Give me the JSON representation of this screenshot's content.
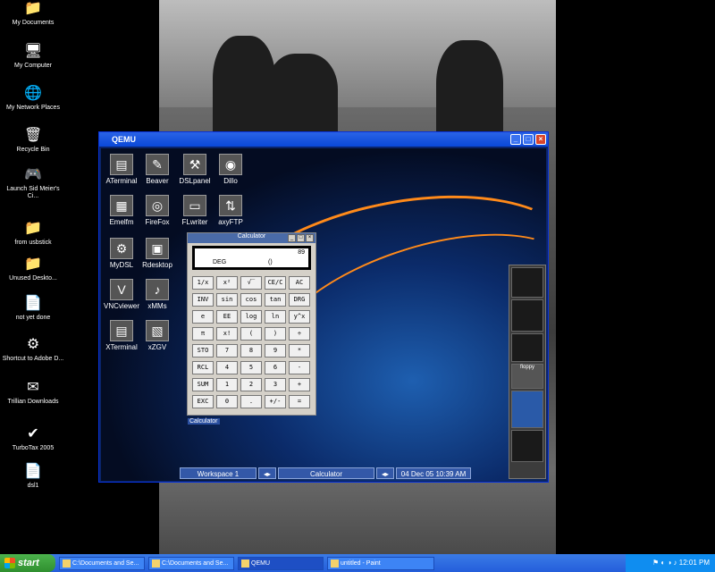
{
  "desktop_icons": [
    {
      "name": "my-documents-icon",
      "label": "My Documents",
      "glyph": "📁"
    },
    {
      "name": "my-computer-icon",
      "label": "My Computer",
      "glyph": "🖥"
    },
    {
      "name": "network-places-icon",
      "label": "My Network Places",
      "glyph": "🌐"
    },
    {
      "name": "recycle-bin-icon",
      "label": "Recycle Bin",
      "glyph": "🗑"
    },
    {
      "name": "civ-icon",
      "label": "Launch Sid Meier's Ci...",
      "glyph": "🎮"
    },
    {
      "name": "folder-icon",
      "label": "from usbstick",
      "glyph": "📁"
    },
    {
      "name": "folder-icon",
      "label": "Unused Deskto...",
      "glyph": "📁"
    },
    {
      "name": "document-icon",
      "label": "not yet done",
      "glyph": "📄"
    },
    {
      "name": "shortcut-icon",
      "label": "Shortcut to Adobe D...",
      "glyph": "⚙"
    },
    {
      "name": "trillian-icon",
      "label": "Trillian Downloads",
      "glyph": "✉"
    },
    {
      "name": "turbotax-icon",
      "label": "TurboTax 2005",
      "glyph": "✔"
    },
    {
      "name": "dsl-file-icon",
      "label": "dsl1",
      "glyph": "📄"
    }
  ],
  "qemu": {
    "title": "QEMU",
    "icons": [
      {
        "label": "ATerminal",
        "glyph": "▤"
      },
      {
        "label": "Beaver",
        "glyph": "✎"
      },
      {
        "label": "DSLpanel",
        "glyph": "⚒"
      },
      {
        "label": "Dillo",
        "glyph": "◉"
      },
      {
        "label": "Emelfm",
        "glyph": "▦"
      },
      {
        "label": "FireFox",
        "glyph": "◎"
      },
      {
        "label": "FLwriter",
        "glyph": "▭"
      },
      {
        "label": "axyFTP",
        "glyph": "⇅"
      },
      {
        "label": "MyDSL",
        "glyph": "⚙"
      },
      {
        "label": "Rdesktop",
        "glyph": "▣"
      },
      {
        "label": "VNCviewer",
        "glyph": "V"
      },
      {
        "label": "xMMs",
        "glyph": "♪"
      },
      {
        "label": "XTerminal",
        "glyph": "▤"
      },
      {
        "label": "xZGV",
        "glyph": "▧"
      }
    ],
    "calculator": {
      "title": "Calculator",
      "display_value": "89",
      "angle_mode": "DEG",
      "paren": "()",
      "keys": [
        "1/x",
        "x²",
        "√‾",
        "CE/C",
        "AC",
        "INV",
        "sin",
        "cos",
        "tan",
        "DRG",
        "e",
        "EE",
        "log",
        "ln",
        "y^x",
        "π",
        "x!",
        "(",
        ")",
        "÷",
        "STO",
        "7",
        "8",
        "9",
        "*",
        "RCL",
        "4",
        "5",
        "6",
        "-",
        "SUM",
        "1",
        "2",
        "3",
        "+",
        "EXC",
        "0",
        ".",
        "+/-",
        "="
      ],
      "taskbar_label": "Calculator"
    },
    "dock": {
      "floppy_label": "floppy"
    },
    "guest_bar": {
      "workspace": "Workspace 1",
      "task": "Calculator",
      "datetime": "04 Dec 05 10:39 AM"
    }
  },
  "taskbar": {
    "start_label": "start",
    "items": [
      {
        "label": "C:\\Documents and Se...",
        "active": false
      },
      {
        "label": "C:\\Documents and Se...",
        "active": false
      },
      {
        "label": "QEMU",
        "active": true
      },
      {
        "label": "untitled - Paint",
        "active": false
      }
    ],
    "clock": "12:01 PM"
  }
}
